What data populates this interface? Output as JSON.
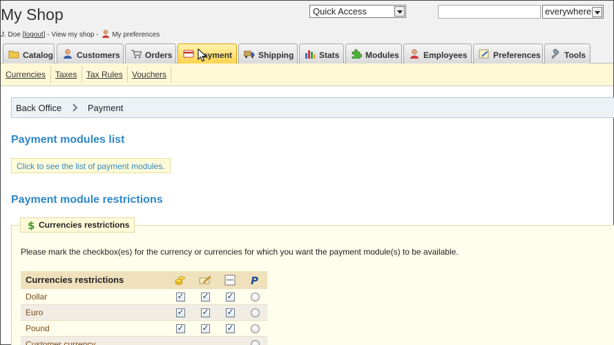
{
  "header": {
    "shop_title": "My Shop",
    "user_prefix": "J. Doe [",
    "logout": "logout",
    "user_mid": "] - View my shop - ",
    "preferences": "My preferences",
    "quick_access": "Quick Access",
    "search_value": "",
    "search_scope": "everywhere"
  },
  "tabs": [
    {
      "label": "Catalog",
      "icon": "folder-icon"
    },
    {
      "label": "Customers",
      "icon": "customer-icon"
    },
    {
      "label": "Orders",
      "icon": "cart-icon"
    },
    {
      "label": "Payment",
      "icon": "payment-icon",
      "active": true
    },
    {
      "label": "Shipping",
      "icon": "truck-icon"
    },
    {
      "label": "Stats",
      "icon": "chart-icon"
    },
    {
      "label": "Modules",
      "icon": "puzzle-icon"
    },
    {
      "label": "Employees",
      "icon": "employee-icon"
    },
    {
      "label": "Preferences",
      "icon": "preferences-icon"
    },
    {
      "label": "Tools",
      "icon": "wrench-icon"
    }
  ],
  "subtabs": [
    "Currencies",
    "Taxes",
    "Tax Rules",
    "Vouchers"
  ],
  "breadcrumb": {
    "home": "Back Office",
    "current": "Payment"
  },
  "sections": {
    "modules_list_title": "Payment modules list",
    "modules_list_link": "Click to see the list of payment modules.",
    "restrictions_title": "Payment module restrictions"
  },
  "fieldset": {
    "legend": "Currencies restrictions",
    "instruction": "Please mark the checkbox(es) for the currency or currencies for which you want the payment module(s) to be available."
  },
  "table": {
    "header": "Currencies restrictions",
    "module_icons": [
      "coins-icon",
      "check-payment-icon",
      "bankwire-icon",
      "paypal-icon"
    ],
    "rows": [
      {
        "name": "Dollar",
        "checks": [
          true,
          true,
          true
        ],
        "radio": false
      },
      {
        "name": "Euro",
        "checks": [
          true,
          true,
          true
        ],
        "radio": false
      },
      {
        "name": "Pound",
        "checks": [
          true,
          true,
          true
        ],
        "radio": false
      },
      {
        "name": "Customer currency",
        "checks": null,
        "radio": false
      }
    ]
  },
  "colors": {
    "accent": "#2f87c5",
    "active_tab": "#ffd24a",
    "subbar": "#fff8d6"
  }
}
